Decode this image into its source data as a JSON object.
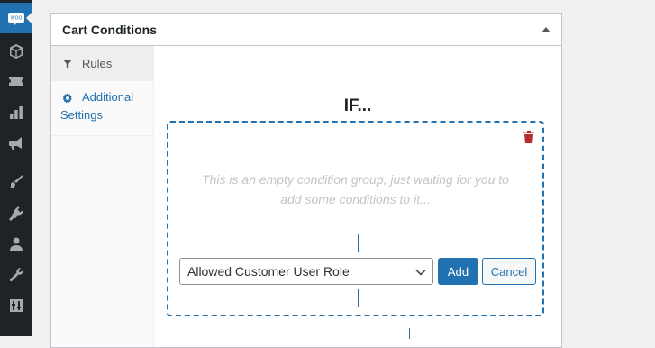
{
  "sidebar": {
    "items": [
      {
        "icon": "woocommerce-icon",
        "active": true
      },
      {
        "icon": "products-box-icon"
      },
      {
        "icon": "coupon-ticket-icon"
      },
      {
        "icon": "analytics-bar-chart-icon"
      },
      {
        "icon": "marketing-megaphone-icon"
      },
      {
        "icon": "appearance-brush-icon"
      },
      {
        "icon": "plugins-plug-icon"
      },
      {
        "icon": "users-person-icon"
      },
      {
        "icon": "tools-wrench-icon"
      },
      {
        "icon": "settings-sliders-icon"
      }
    ],
    "woo_label": "WOO"
  },
  "panel": {
    "title": "Cart Conditions",
    "tabs": [
      {
        "label": "Rules",
        "icon": "funnel-icon"
      },
      {
        "label": "Additional Settings",
        "icon": "gear-icon"
      }
    ]
  },
  "rules": {
    "heading": "IF...",
    "empty_message": "This is an empty condition group, just waiting for you to add some conditions to it...",
    "condition_select": {
      "value": "Allowed Customer User Role"
    },
    "add_label": "Add",
    "cancel_label": "Cancel"
  },
  "colors": {
    "accent": "#2271b1",
    "sidebar": "#1d2327",
    "delete": "#b32d2e"
  }
}
